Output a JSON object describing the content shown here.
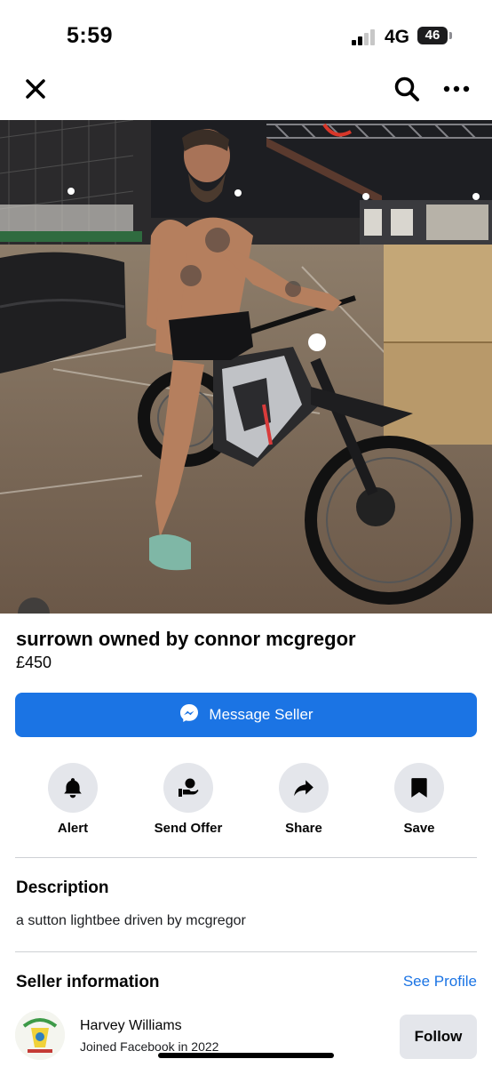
{
  "status_bar": {
    "time": "5:59",
    "network": "4G",
    "battery": "46"
  },
  "listing": {
    "title": "surrown owned by connor mcgregor",
    "price": "£450"
  },
  "primary_action": {
    "label": "Message Seller",
    "color": "#1b74e4"
  },
  "actions": [
    {
      "label": "Alert",
      "icon": "bell-icon"
    },
    {
      "label": "Send Offer",
      "icon": "send-offer-icon"
    },
    {
      "label": "Share",
      "icon": "share-icon"
    },
    {
      "label": "Save",
      "icon": "bookmark-icon"
    }
  ],
  "description": {
    "heading": "Description",
    "text": "a sutton lightbee driven by mcgregor"
  },
  "seller": {
    "heading": "Seller information",
    "see_profile": "See Profile",
    "name": "Harvey Williams",
    "joined": "Joined Facebook in 2022",
    "follow_label": "Follow"
  }
}
